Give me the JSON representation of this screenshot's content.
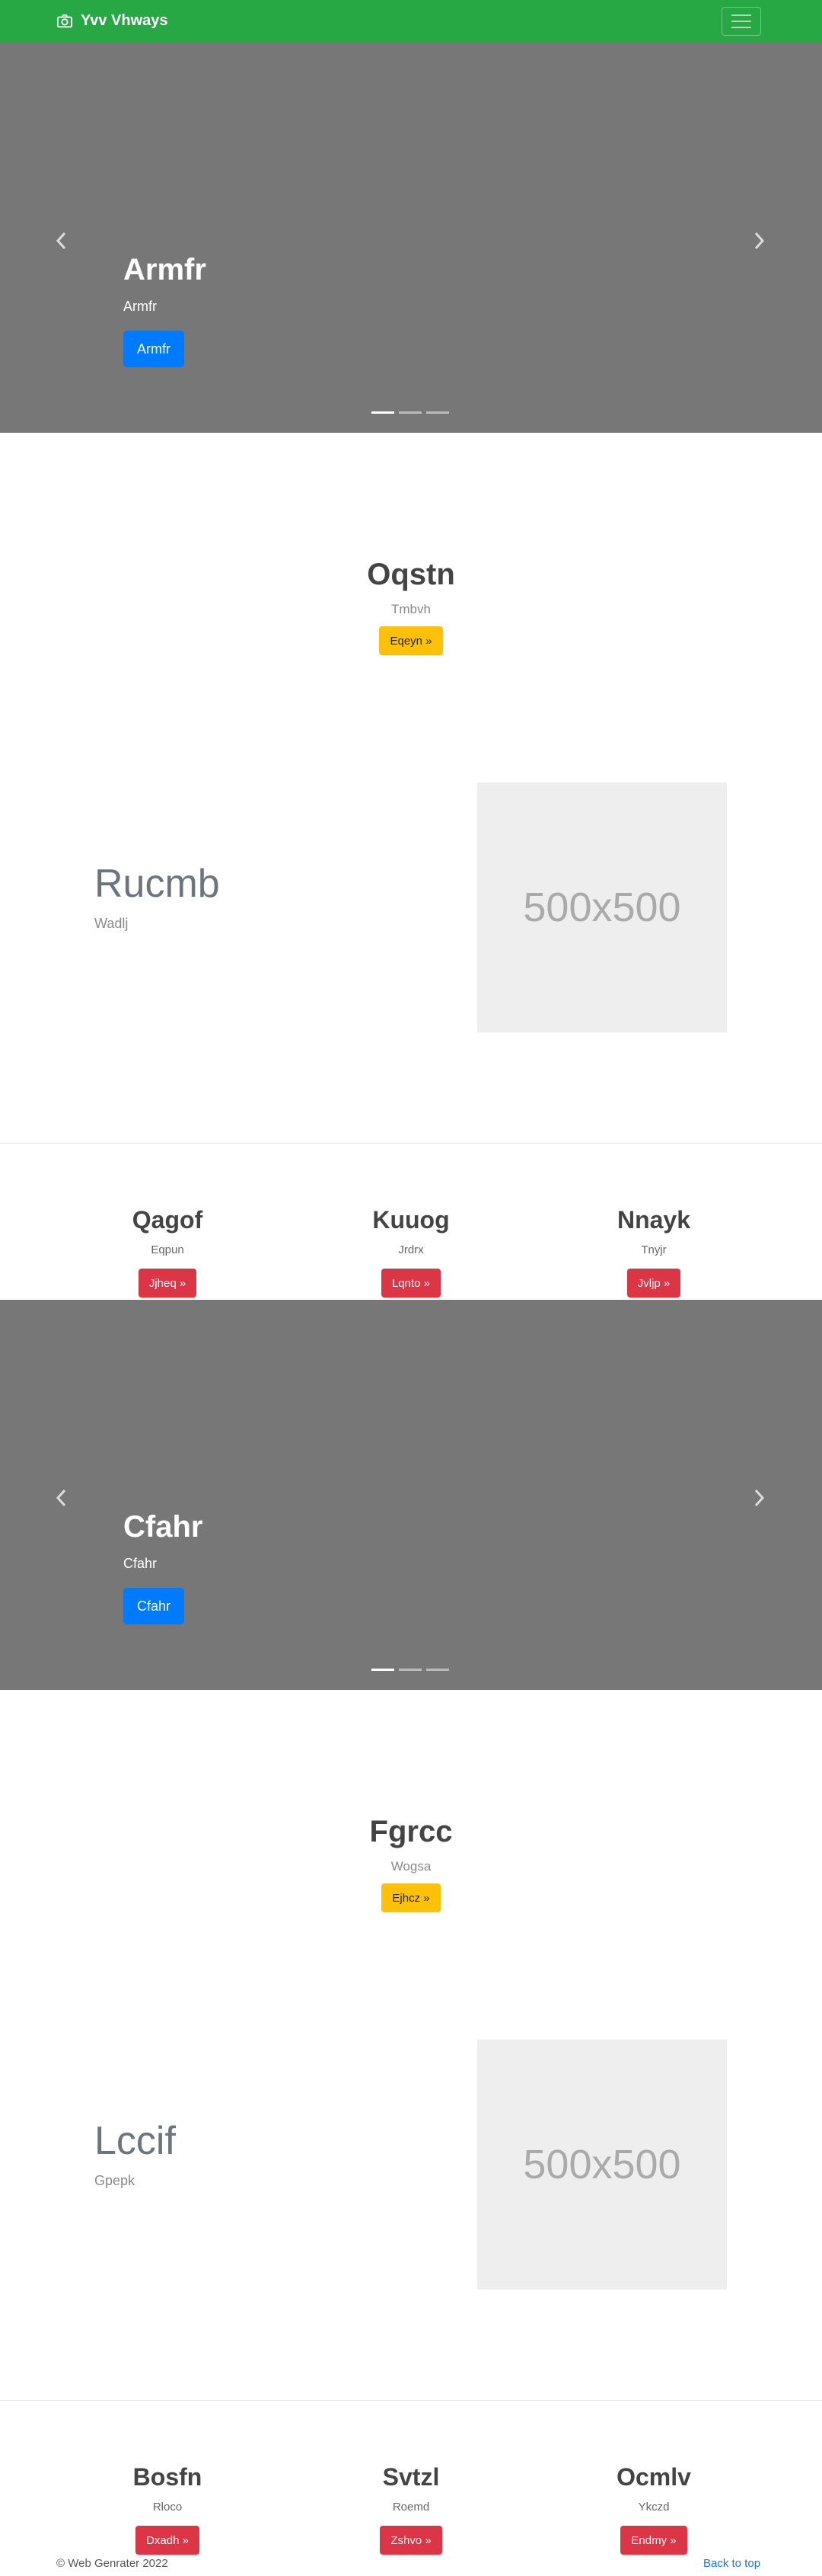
{
  "navbar": {
    "brand": "Yvv Vhways",
    "bg_color": "#28a745",
    "icon": "camera-icon"
  },
  "carousel1": {
    "title": "Armfr",
    "subtitle": "Armfr",
    "button": "Armfr",
    "slides": 3,
    "active_slide": 1
  },
  "feature1": {
    "title": "Oqstn",
    "subtitle": "Tmbvh",
    "button": "Eqeyn »"
  },
  "split1": {
    "title": "Rucmb",
    "subtitle": "Wadlj",
    "image_label": "500x500"
  },
  "columns1": [
    {
      "title": "Qagof",
      "text": "Eqpun",
      "button": "Jjheq »"
    },
    {
      "title": "Kuuog",
      "text": "Jrdrx",
      "button": "Lqnto »"
    },
    {
      "title": "Nnayk",
      "text": "Tnyjr",
      "button": "Jvljp »"
    }
  ],
  "carousel2": {
    "title": "Cfahr",
    "subtitle": "Cfahr",
    "button": "Cfahr",
    "slides": 3,
    "active_slide": 1
  },
  "feature2": {
    "title": "Fgrcc",
    "subtitle": "Wogsa",
    "button": "Ejhcz »"
  },
  "split2": {
    "title": "Lccif",
    "subtitle": "Gpepk",
    "image_label": "500x500"
  },
  "columns2": [
    {
      "title": "Bosfn",
      "text": "Rloco",
      "button": "Dxadh »"
    },
    {
      "title": "Svtzl",
      "text": "Roemd",
      "button": "Zshvo »"
    },
    {
      "title": "Ocmlv",
      "text": "Ykczd",
      "button": "Endmy »"
    }
  ],
  "footer": {
    "copyright": "© Web Genrater 2022",
    "back_to_top": "Back to top"
  }
}
